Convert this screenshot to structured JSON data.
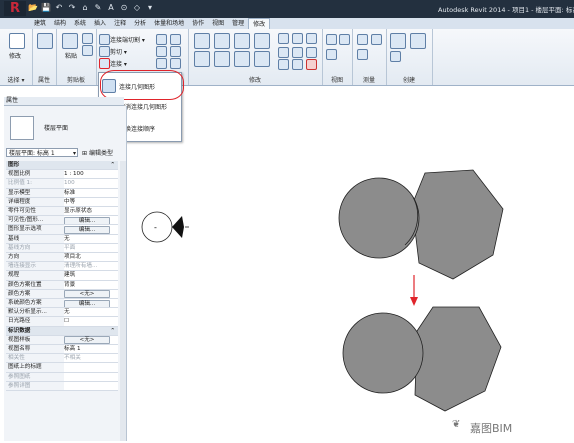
{
  "app": {
    "logo_glyph": "R",
    "title": "Autodesk Revit 2014 -   项目1 - 楼层平面: 标高"
  },
  "quick_access": [
    "📂",
    "💾",
    "↶",
    "↷",
    "⌂",
    "✎",
    "A",
    "⊙",
    "◇",
    "▾"
  ],
  "tabs": [
    "建筑",
    "结构",
    "系统",
    "插入",
    "注释",
    "分析",
    "体量和场地",
    "协作",
    "视图",
    "管理",
    "修改"
  ],
  "active_tab_index": 10,
  "ribbon": {
    "groups": [
      {
        "label": "选择 ▾"
      },
      {
        "label": "属性"
      },
      {
        "label": "剪贴板"
      },
      {
        "label": "修改"
      },
      {
        "label": "视图"
      },
      {
        "label": "测量"
      },
      {
        "label": "创建"
      }
    ],
    "modify_label": "修改",
    "paste_label": "粘贴",
    "cut_label": "连接端切割 ▾",
    "clip_label": "剪切 ▾",
    "join_label": "连接 ▾",
    "join_small_glyph": "✂"
  },
  "dropdown": {
    "items": [
      {
        "label": "连接几何图形"
      },
      {
        "label": "取消连接几何图形"
      },
      {
        "label": "切换连接顺序"
      }
    ]
  },
  "properties": {
    "header": "属性",
    "type_name": "楼层平面",
    "selector": "楼层平面: 标高 1",
    "edit_type": "编辑类型",
    "rows": [
      {
        "name": "图形",
        "value": "",
        "section": true
      },
      {
        "name": "视图比例",
        "value": "1 : 100"
      },
      {
        "name": "比例值 1:",
        "value": "100",
        "disabled": true
      },
      {
        "name": "显示模型",
        "value": "标准"
      },
      {
        "name": "详细程度",
        "value": "中等"
      },
      {
        "name": "零件可见性",
        "value": "显示原状态"
      },
      {
        "name": "可见性/图形...",
        "value": "编辑...",
        "button": true
      },
      {
        "name": "图形显示选项",
        "value": "编辑...",
        "button": true
      },
      {
        "name": "基线",
        "value": "无"
      },
      {
        "name": "基线方向",
        "value": "平面",
        "disabled": true
      },
      {
        "name": "方向",
        "value": "项目北"
      },
      {
        "name": "墙连接显示",
        "value": "清理所有墙...",
        "disabled": true
      },
      {
        "name": "规程",
        "value": "建筑"
      },
      {
        "name": "颜色方案位置",
        "value": "背景"
      },
      {
        "name": "颜色方案",
        "value": "<无>",
        "button": true
      },
      {
        "name": "系统颜色方案",
        "value": "编辑...",
        "button": true
      },
      {
        "name": "默认分析显示...",
        "value": "无"
      },
      {
        "name": "日光路径",
        "value": "☐"
      },
      {
        "name": "标识数据",
        "value": "",
        "section": true
      },
      {
        "name": "视图样板",
        "value": "<无>",
        "button": true
      },
      {
        "name": "视图名称",
        "value": "标高 1"
      },
      {
        "name": "相关性",
        "value": "不相关",
        "disabled": true
      },
      {
        "name": "图纸上的标题",
        "value": ""
      },
      {
        "name": "参照图纸",
        "value": "",
        "disabled": true
      },
      {
        "name": "参照详图",
        "value": "",
        "disabled": true
      }
    ]
  },
  "canvas": {
    "elevation_marker_label": "-",
    "shape_fill": "#8c8c8c",
    "arrow_color": "#e0242b"
  },
  "watermark": "嘉图BIM",
  "watermark_icon": "wechat-icon"
}
